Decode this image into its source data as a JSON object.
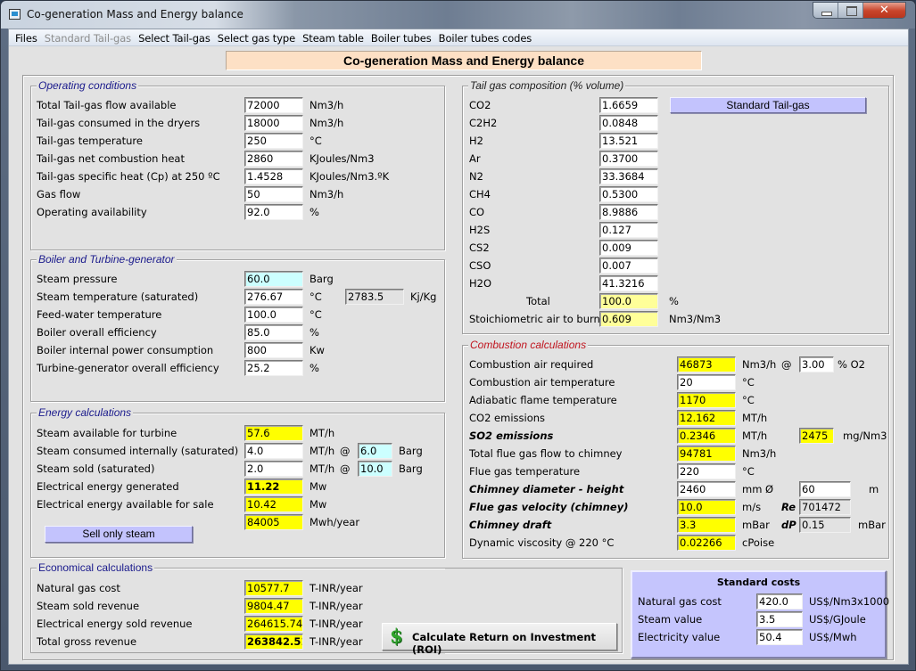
{
  "window": {
    "title": "Co-generation Mass and Energy balance",
    "icon": "app-window-icon",
    "controls": [
      "minimize",
      "maximize",
      "close"
    ],
    "close_glyph": "✕"
  },
  "menu": [
    {
      "label": "Files",
      "enabled": true
    },
    {
      "label": "Standard Tail-gas",
      "enabled": false
    },
    {
      "label": "Select Tail-gas",
      "enabled": true
    },
    {
      "label": "Select gas type",
      "enabled": true
    },
    {
      "label": "Steam table",
      "enabled": true
    },
    {
      "label": "Boiler tubes",
      "enabled": true
    },
    {
      "label": "Boiler tubes codes",
      "enabled": true
    }
  ],
  "banner": "Co-generation Mass and Energy balance",
  "operating": {
    "title": "Operating conditions",
    "rows": [
      {
        "label": "Total Tail-gas flow available",
        "value": "72000",
        "unit": "Nm3/h"
      },
      {
        "label": "Tail-gas consumed in the dryers",
        "value": "18000",
        "unit": "Nm3/h"
      },
      {
        "label": "Tail-gas temperature",
        "value": "250",
        "unit": "°C"
      },
      {
        "label": "Tail-gas net combustion heat",
        "value": "2860",
        "unit": "KJoules/Nm3"
      },
      {
        "label": "Tail-gas specific heat (Cp) at 250 ºC",
        "value": "1.4528",
        "unit": "KJoules/Nm3.ºK"
      },
      {
        "label": "Gas flow",
        "value": "50",
        "unit": "Nm3/h"
      },
      {
        "label": "Operating availability",
        "value": "92.0",
        "unit": "%"
      }
    ]
  },
  "boiler": {
    "title": "Boiler and Turbine-generator",
    "rows": [
      {
        "label": "Steam pressure",
        "value": "60.0",
        "unit": "Barg"
      },
      {
        "label": "Steam temperature (saturated)",
        "value": "276.67",
        "unit": "°C",
        "extra_value": "2783.5",
        "extra_unit": "Kj/Kg"
      },
      {
        "label": "Feed-water temperature",
        "value": "100.0",
        "unit": "°C"
      },
      {
        "label": "Boiler overall efficiency",
        "value": "85.0",
        "unit": "%"
      },
      {
        "label": "Boiler internal power consumption",
        "value": "800",
        "unit": "Kw"
      },
      {
        "label": "Turbine-generator overall efficiency",
        "value": "25.2",
        "unit": "%"
      }
    ]
  },
  "energy": {
    "title": "Energy calculations",
    "rows": [
      {
        "label": "Steam available for turbine",
        "value": "57.6",
        "unit": "MT/h"
      },
      {
        "label": "Steam consumed internally (saturated)",
        "value": "4.0",
        "unit": "MT/h",
        "at": "@",
        "pressure": "6.0",
        "pressure_unit": "Barg"
      },
      {
        "label": "Steam sold (saturated)",
        "value": "2.0",
        "unit": "MT/h",
        "at": "@",
        "pressure": "10.0",
        "pressure_unit": "Barg"
      },
      {
        "label": "Electrical energy generated",
        "value": "11.22",
        "unit": "Mw"
      },
      {
        "label": "Electrical energy available for sale",
        "value": "10.42",
        "unit": "Mw"
      },
      {
        "label": "",
        "value": "84005",
        "unit": "Mwh/year"
      }
    ],
    "sell_button": "Sell only steam"
  },
  "economical": {
    "title": "Economical calculations",
    "rows": [
      {
        "label": "Natural gas cost",
        "value": "10577.7",
        "unit": "T-INR/year"
      },
      {
        "label": "Steam sold revenue",
        "value": "9804.47",
        "unit": "T-INR/year"
      },
      {
        "label": "Electrical energy sold revenue",
        "value": "264615.74",
        "unit": "T-INR/year"
      },
      {
        "label": "Total gross revenue",
        "value": "263842.51",
        "unit": "T-INR/year"
      }
    ],
    "roi_button": "Calculate Return on Investment (ROI)",
    "roi_icon": "$"
  },
  "tailgas": {
    "title": "Tail gas composition (% volume)",
    "components": [
      {
        "label": "CO2",
        "value": "1.6659"
      },
      {
        "label": "C2H2",
        "value": "0.0848"
      },
      {
        "label": "H2",
        "value": "13.521"
      },
      {
        "label": "Ar",
        "value": "0.3700"
      },
      {
        "label": "N2",
        "value": "33.3684"
      },
      {
        "label": "CH4",
        "value": "0.5300"
      },
      {
        "label": "CO",
        "value": "8.9886"
      },
      {
        "label": "H2S",
        "value": "0.127"
      },
      {
        "label": "CS2",
        "value": "0.009"
      },
      {
        "label": "CSO",
        "value": "0.007"
      },
      {
        "label": "H2O",
        "value": "41.3216"
      }
    ],
    "total_label": "Total",
    "total_value": "100.0",
    "total_unit": "%",
    "stoich_label": "Stoichiometric air to burn",
    "stoich_value": "0.609",
    "stoich_unit": "Nm3/Nm3",
    "standard_button": "Standard Tail-gas"
  },
  "combustion": {
    "title": "Combustion calculations",
    "air_required": {
      "label": "Combustion air required",
      "value": "46873",
      "unit": "Nm3/h",
      "at": "@",
      "o2_value": "3.00",
      "o2_unit": "% O2"
    },
    "air_temp": {
      "label": "Combustion air temperature",
      "value": "20",
      "unit": "°C"
    },
    "flame_temp": {
      "label": "Adiabatic flame temperature",
      "value": "1170",
      "unit": "°C"
    },
    "co2": {
      "label": "CO2 emissions",
      "value": "12.162",
      "unit": "MT/h"
    },
    "so2": {
      "label": "SO2 emissions",
      "value": "0.2346",
      "unit": "MT/h",
      "conc_value": "2475",
      "conc_unit": "mg/Nm3"
    },
    "flue_flow": {
      "label": "Total flue gas flow to chimney",
      "value": "94781",
      "unit": "Nm3/h"
    },
    "flue_temp": {
      "label": "Flue gas temperature",
      "value": "220",
      "unit": "°C"
    },
    "chimney_dim": {
      "label": "Chimney diameter - height",
      "value": "2460",
      "unit": "mm Ø",
      "height_value": "60",
      "height_unit": "m"
    },
    "velocity": {
      "label": "Flue gas velocity (chimney)",
      "value": "10.0",
      "unit": "m/s",
      "re_label": "Re",
      "re_value": "701472"
    },
    "draft": {
      "label": "Chimney draft",
      "value": "3.3",
      "unit": "mBar",
      "dp_label": "dP",
      "dp_value": "0.15",
      "dp_unit": "mBar"
    },
    "viscosity": {
      "label": "Dynamic viscosity @ 220 °C",
      "value": "0.02266",
      "unit": "cPoise"
    }
  },
  "standard_costs": {
    "title": "Standard costs",
    "rows": [
      {
        "label": "Natural gas cost",
        "value": "420.0",
        "unit": "US$/Nm3x1000"
      },
      {
        "label": "Steam value",
        "value": "3.5",
        "unit": "US$/GJoule"
      },
      {
        "label": "Electricity value",
        "value": "50.4",
        "unit": "US$/Mwh"
      }
    ]
  }
}
